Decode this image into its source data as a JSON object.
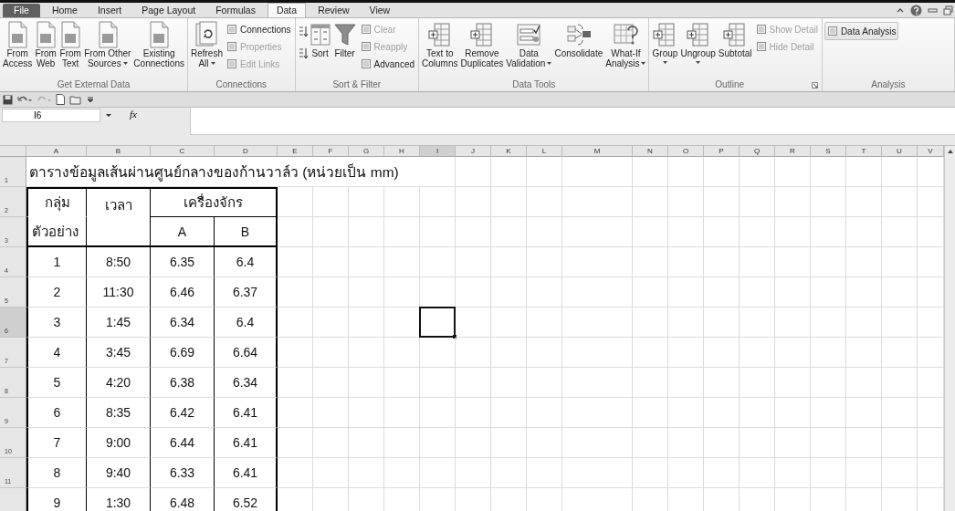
{
  "tabs": [
    {
      "label": "File",
      "kind": "file",
      "selected": false
    },
    {
      "label": "Home",
      "kind": "tab",
      "selected": false
    },
    {
      "label": "Insert",
      "kind": "tab",
      "selected": false
    },
    {
      "label": "Page Layout",
      "kind": "tab",
      "selected": false
    },
    {
      "label": "Formulas",
      "kind": "tab",
      "selected": false
    },
    {
      "label": "Data",
      "kind": "tab",
      "selected": true
    },
    {
      "label": "Review",
      "kind": "tab",
      "selected": false
    },
    {
      "label": "View",
      "kind": "tab",
      "selected": false
    }
  ],
  "ribbon_groups": [
    {
      "label": "Get External Data",
      "launcher": false,
      "items": [
        {
          "kind": "large",
          "lines": [
            "From",
            "Access"
          ]
        },
        {
          "kind": "large",
          "lines": [
            "From",
            "Web"
          ]
        },
        {
          "kind": "large",
          "lines": [
            "From",
            "Text"
          ]
        },
        {
          "kind": "large",
          "lines": [
            "From Other",
            "Sources"
          ],
          "dropdown": true
        },
        {
          "kind": "large",
          "lines": [
            "Existing",
            "Connections"
          ]
        }
      ]
    },
    {
      "label": "Connections",
      "launcher": false,
      "items": [
        {
          "kind": "large",
          "lines": [
            "Refresh",
            "All"
          ],
          "dropdown": true
        },
        {
          "kind": "stack",
          "items": [
            {
              "label": "Connections",
              "disabled": false
            },
            {
              "label": "Properties",
              "disabled": true
            },
            {
              "label": "Edit Links",
              "disabled": true
            }
          ]
        }
      ]
    },
    {
      "label": "Sort & Filter",
      "launcher": false,
      "items": [
        {
          "kind": "sort_pair"
        },
        {
          "kind": "large",
          "lines": [
            "Sort"
          ]
        },
        {
          "kind": "large",
          "lines": [
            "Filter"
          ]
        },
        {
          "kind": "stack",
          "items": [
            {
              "label": "Clear",
              "disabled": true
            },
            {
              "label": "Reapply",
              "disabled": true
            },
            {
              "label": "Advanced",
              "disabled": false
            }
          ]
        }
      ]
    },
    {
      "label": "Data Tools",
      "launcher": false,
      "items": [
        {
          "kind": "large",
          "lines": [
            "Text to",
            "Columns"
          ]
        },
        {
          "kind": "large",
          "lines": [
            "Remove",
            "Duplicates"
          ]
        },
        {
          "kind": "large",
          "lines": [
            "Data",
            "Validation"
          ],
          "dropdown": true
        },
        {
          "kind": "large",
          "lines": [
            "Consolidate"
          ]
        },
        {
          "kind": "large",
          "lines": [
            "What-If",
            "Analysis"
          ],
          "dropdown": true
        }
      ]
    },
    {
      "label": "Outline",
      "launcher": true,
      "items": [
        {
          "kind": "large",
          "lines": [
            "Group"
          ],
          "dropdown": true
        },
        {
          "kind": "large",
          "lines": [
            "Ungroup"
          ],
          "dropdown": true
        },
        {
          "kind": "large",
          "lines": [
            "Subtotal"
          ]
        },
        {
          "kind": "stack",
          "items": [
            {
              "label": "Show Detail",
              "disabled": true
            },
            {
              "label": "Hide Detail",
              "disabled": true
            }
          ]
        }
      ]
    },
    {
      "label": "Analysis",
      "launcher": false,
      "items": [
        {
          "kind": "stack",
          "items": [
            {
              "label": "Data Analysis",
              "disabled": false,
              "highlighted": true
            }
          ]
        }
      ]
    }
  ],
  "formula_bar": {
    "name_box": "I6",
    "function_label": "fx"
  },
  "sheet": {
    "columns": [
      {
        "label": "A",
        "selected": false
      },
      {
        "label": "B",
        "selected": false
      },
      {
        "label": "C",
        "selected": false
      },
      {
        "label": "D",
        "selected": false
      },
      {
        "label": "E",
        "selected": false
      },
      {
        "label": "F",
        "selected": false
      },
      {
        "label": "G",
        "selected": false
      },
      {
        "label": "H",
        "selected": false
      },
      {
        "label": "I",
        "selected": true
      },
      {
        "label": "J",
        "selected": false
      },
      {
        "label": "K",
        "selected": false
      },
      {
        "label": "L",
        "selected": false
      },
      {
        "label": "M",
        "selected": false
      },
      {
        "label": "N",
        "selected": false
      },
      {
        "label": "O",
        "selected": false
      },
      {
        "label": "P",
        "selected": false
      },
      {
        "label": "Q",
        "selected": false
      },
      {
        "label": "R",
        "selected": false
      },
      {
        "label": "S",
        "selected": false
      },
      {
        "label": "T",
        "selected": false
      },
      {
        "label": "U",
        "selected": false
      },
      {
        "label": "V",
        "selected": false
      }
    ],
    "row_headers": [
      {
        "label": "1",
        "selected": false
      },
      {
        "label": "2",
        "selected": false
      },
      {
        "label": "3",
        "selected": false
      },
      {
        "label": "4",
        "selected": false
      },
      {
        "label": "5",
        "selected": false
      },
      {
        "label": "6",
        "selected": true
      },
      {
        "label": "7",
        "selected": false
      },
      {
        "label": "8",
        "selected": false
      },
      {
        "label": "9",
        "selected": false
      },
      {
        "label": "10",
        "selected": false
      },
      {
        "label": "11",
        "selected": false
      }
    ],
    "title": "ตารางข้อมูลเส้นผ่านศูนย์กลางของก้านวาล์ว  (หน่วยเป็น  mm)",
    "table": {
      "group_header": [
        "กลุ่ม",
        "ตัวอย่าง"
      ],
      "time_header": "เวลา",
      "machine_header": "เครื่องจักร",
      "machine_columns": [
        "A",
        "B"
      ],
      "rows": [
        [
          "1",
          "8:50",
          "6.35",
          "6.4"
        ],
        [
          "2",
          "11:30",
          "6.46",
          "6.37"
        ],
        [
          "3",
          "1:45",
          "6.34",
          "6.4"
        ],
        [
          "4",
          "3:45",
          "6.69",
          "6.64"
        ],
        [
          "5",
          "4:20",
          "6.38",
          "6.34"
        ],
        [
          "6",
          "8:35",
          "6.42",
          "6.41"
        ],
        [
          "7",
          "9:00",
          "6.44",
          "6.41"
        ],
        [
          "8",
          "9:40",
          "6.33",
          "6.41"
        ],
        [
          "9",
          "1:30",
          "6.48",
          "6.52"
        ]
      ]
    }
  }
}
